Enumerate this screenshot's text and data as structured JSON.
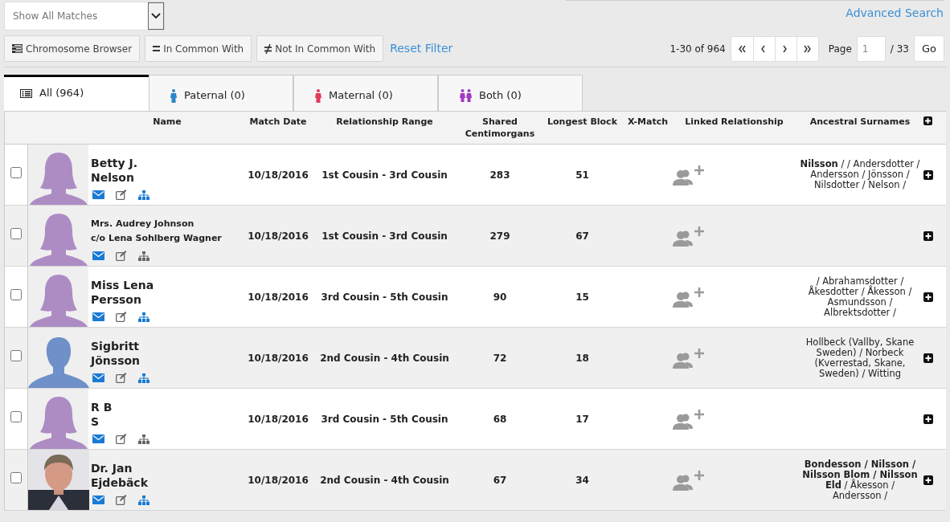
{
  "filter_select": {
    "value": "Show All Matches"
  },
  "advanced_search": "Advanced Search",
  "toolbar": [
    {
      "kind": "chromosome",
      "label": "Chromosome Browser"
    },
    {
      "kind": "equal",
      "label": "In Common With"
    },
    {
      "kind": "notequal",
      "label": "Not In Common With"
    }
  ],
  "reset_filter": "Reset Filter",
  "pagination": {
    "range": "1-30 of 964",
    "page_label": "Page",
    "page_value": "1",
    "page_total": "/ 33",
    "go": "Go"
  },
  "tabs": [
    {
      "kind": "all",
      "label": "All (964)",
      "selected": true
    },
    {
      "kind": "paternal",
      "label": "Paternal (0)",
      "selected": false
    },
    {
      "kind": "maternal",
      "label": "Maternal (0)",
      "selected": false
    },
    {
      "kind": "both",
      "label": "Both (0)",
      "selected": false
    }
  ],
  "table": {
    "columns": [
      "Name",
      "Match Date",
      "Relationship Range",
      "Shared Centimorgans",
      "Longest Block",
      "X-Match",
      "Linked Relationship",
      "Ancestral Surnames"
    ],
    "rows": [
      {
        "checked": false,
        "avatar": {
          "kind": "female"
        },
        "name": [
          "Betty J.",
          "Nelson"
        ],
        "tree_linked": true,
        "match_date": "10/18/2016",
        "relationship_range": "1st Cousin - 3rd Cousin",
        "shared_cm": "283",
        "longest_block": "51",
        "surnames": "**Nilsson** / / Andersdotter / Andersson / Jönsson / Nilsdotter / Nelson /"
      },
      {
        "checked": false,
        "avatar": {
          "kind": "female"
        },
        "name": [
          "Mrs. Audrey Johnson",
          "c/o Lena Sohlberg Wagner"
        ],
        "tree_linked": false,
        "match_date": "10/18/2016",
        "relationship_range": "1st Cousin - 3rd Cousin",
        "shared_cm": "279",
        "longest_block": "67"
      },
      {
        "checked": false,
        "avatar": {
          "kind": "female"
        },
        "name": [
          "Miss Lena",
          "Persson"
        ],
        "tree_linked": true,
        "match_date": "10/18/2016",
        "relationship_range": "3rd Cousin - 5th Cousin",
        "shared_cm": "90",
        "longest_block": "15",
        "surnames": "/ Abrahamsdotter / Åkesdotter / Åkesson / Asmundsson / Albrektsdotter /"
      },
      {
        "checked": false,
        "avatar": {
          "kind": "male"
        },
        "name": [
          "Sigbritt",
          "Jönsson"
        ],
        "tree_linked": true,
        "match_date": "10/18/2016",
        "relationship_range": "2nd Cousin - 4th Cousin",
        "shared_cm": "72",
        "longest_block": "18",
        "surnames": "Hollbeck (Vallby, Skane Sweden) / Norbeck (Kverrestad, Skane, Sweden) / Witting"
      },
      {
        "checked": false,
        "avatar": {
          "kind": "female"
        },
        "name": [
          "R B",
          "S"
        ],
        "tree_linked": false,
        "match_date": "10/18/2016",
        "relationship_range": "3rd Cousin - 5th Cousin",
        "shared_cm": "68",
        "longest_block": "17"
      },
      {
        "checked": false,
        "avatar": {
          "kind": "picture"
        },
        "name": [
          "Dr. Jan",
          "Ejdebäck"
        ],
        "tree_linked": true,
        "match_date": "10/18/2016",
        "relationship_range": "2nd Cousin - 4th Cousin",
        "shared_cm": "67",
        "longest_block": "34",
        "surnames": "**Bondesson / Nilsson / Nilsson Blom / Nilsson Eld** / Åkesson / Andersson /"
      }
    ]
  }
}
